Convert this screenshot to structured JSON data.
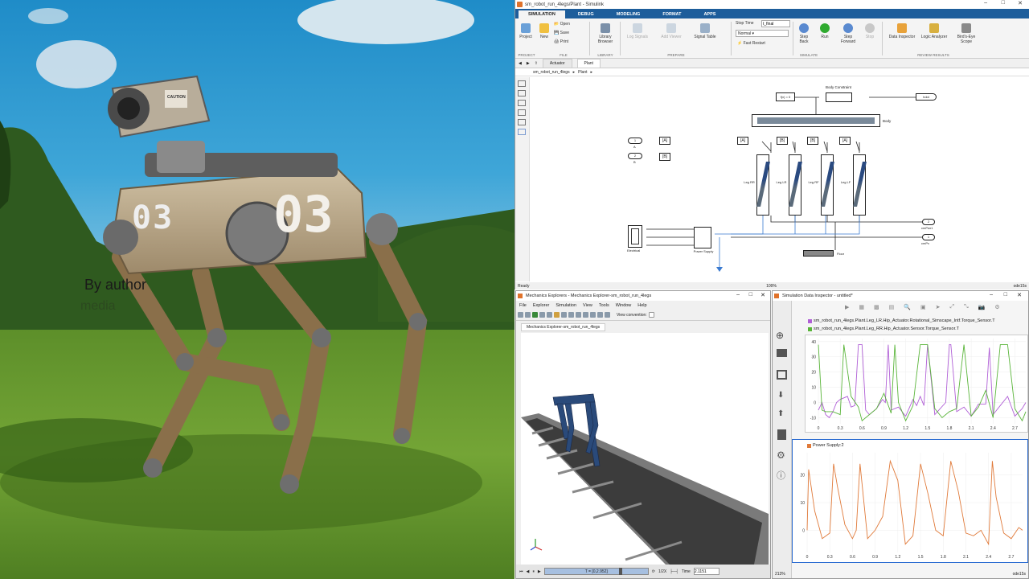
{
  "photo": {
    "watermark": "By author",
    "subwatermark": "media",
    "robot_number_left": "03",
    "robot_number_front": "03",
    "caution": "CAUTION"
  },
  "simulink": {
    "window_title": "sm_robot_run_4legs/Plant - Simulink",
    "tabs": [
      "SIMULATION",
      "DEBUG",
      "MODELING",
      "FORMAT",
      "APPS"
    ],
    "active_tab": "SIMULATION",
    "ribbon": {
      "project": "Project",
      "new": "New",
      "open": "Open",
      "save": "Save",
      "print": "Print",
      "library_browser": "Library Browser",
      "log_signals": "Log Signals",
      "add_viewer": "Add Viewer",
      "signal_table": "Signal Table",
      "stop_time_label": "Stop Time",
      "stop_time": "t_final",
      "mode": "Normal",
      "fast_restart": "Fast Restart",
      "step_back": "Step Back",
      "run": "Run",
      "step_forward": "Step Forward",
      "stop": "Stop",
      "data_inspector": "Data Inspector",
      "logic_analyzer": "Logic Analyzer",
      "birds_eye": "Bird's-Eye Scope",
      "groups": [
        "PROJECT",
        "FILE",
        "LIBRARY",
        "PREPARE",
        "SIMULATE",
        "REVIEW RESULTS"
      ]
    },
    "doc_tabs": [
      "Actuator",
      "Plant"
    ],
    "breadcrumb": [
      "sm_robot_run_4legs",
      "Plant"
    ],
    "status_left": "Ready",
    "status_mid": "109%",
    "status_right": "ode15s",
    "diagram": {
      "fx": "f(x) = 0",
      "body_constraint": "Body Constraint",
      "hdot": "hdot",
      "body": "Body",
      "inA": "1",
      "inB": "2",
      "portA": "A",
      "portB": "B",
      "gotoA": "[A]",
      "gotoB": "[B]",
      "legs": [
        {
          "tag": "[A]",
          "name": "Leg RR"
        },
        {
          "tag": "[B]",
          "name": "Leg LR"
        },
        {
          "tag": "[B]",
          "name": "Leg RF"
        },
        {
          "tag": "[A]",
          "name": "Leg LF"
        }
      ],
      "out2": "2",
      "out1": "1",
      "out2_name": "cmPwr1",
      "out1_name": "cmPx",
      "electrical": "Electrical",
      "power": "Power Supply",
      "floor": "Floor"
    }
  },
  "mechanics": {
    "title": "Mechanics Explorers - Mechanics Explorer-sm_robot_run_4legs",
    "menu": [
      "File",
      "Explorer",
      "Simulation",
      "View",
      "Tools",
      "Window",
      "Help"
    ],
    "view_convention": "View convention:",
    "tab": "Mechanics Explorer-sm_robot_run_4legs",
    "time_readout": "T = [0,2.952]",
    "speed": "1/2X",
    "time_label": "Time",
    "time_value": "2.1151"
  },
  "sdi": {
    "title": "Simulation Data Inspector - untitled*",
    "legend1": "sm_robot_run_4legs.Plant.Leg_LR.Hip_Actuator.Rotational_Simscape_Intf.Torque_Sensor.T",
    "legend2": "sm_robot_run_4legs.Plant.Leg_RR.Hip_Actuator.Sensor.Torque_Sensor.T",
    "legend3": "Power Supply:2",
    "status_left": "213%",
    "status_right": "ode15s",
    "colors": {
      "purple": "#b05fd6",
      "green": "#5ab53a",
      "orange": "#e07a3a"
    }
  },
  "chart_data": [
    {
      "type": "line",
      "title": "",
      "xlabel": "",
      "ylabel": "",
      "x_ticks": [
        "0",
        "0.3",
        "0.6",
        "0.9",
        "1.2",
        "1.5",
        "1.8",
        "2.1",
        "2.4",
        "2.7"
      ],
      "y_ticks": [
        "40",
        "30",
        "20",
        "10",
        "0",
        "-10"
      ],
      "ylim": [
        -14,
        42
      ],
      "xlim": [
        0,
        2.85
      ],
      "series": [
        {
          "name": "sm_robot_run_4legs.Plant.Leg_LR.Hip_Actuator.Rotational_Simscape_Intf.Torque_Sensor.T",
          "color": "#b05fd6",
          "x": [
            0,
            0.05,
            0.1,
            0.15,
            0.2,
            0.25,
            0.3,
            0.4,
            0.45,
            0.5,
            0.55,
            0.6,
            0.65,
            0.7,
            0.8,
            0.88,
            0.92,
            0.96,
            1.0,
            1.1,
            1.2,
            1.3,
            1.35,
            1.4,
            1.45,
            1.5,
            1.6,
            1.75,
            1.8,
            1.82,
            1.9,
            2.0,
            2.1,
            2.2,
            2.3,
            2.35,
            2.4,
            2.5,
            2.6,
            2.7,
            2.8,
            2.85
          ],
          "y": [
            -5,
            0,
            -8,
            -10,
            -6,
            0,
            2,
            4,
            -3,
            -2,
            38,
            38,
            -5,
            -8,
            -4,
            2,
            0,
            38,
            -5,
            -3,
            -9,
            2,
            -2,
            4,
            -2,
            38,
            -8,
            0,
            38,
            38,
            -6,
            -3,
            -9,
            -1,
            -1,
            36,
            -8,
            -2,
            4,
            -9,
            -4,
            0
          ]
        },
        {
          "name": "sm_robot_run_4legs.Plant.Leg_RR.Hip_Actuator.Sensor.Torque_Sensor.T",
          "color": "#5ab53a",
          "x": [
            0,
            0.05,
            0.1,
            0.2,
            0.3,
            0.35,
            0.45,
            0.55,
            0.6,
            0.7,
            0.8,
            0.9,
            1.0,
            1.05,
            1.1,
            1.2,
            1.3,
            1.4,
            1.5,
            1.6,
            1.7,
            1.8,
            1.9,
            2.0,
            2.1,
            2.2,
            2.3,
            2.4,
            2.5,
            2.6,
            2.7,
            2.8,
            2.85
          ],
          "y": [
            38,
            -5,
            -6,
            -6,
            -8,
            38,
            4,
            -3,
            -12,
            -8,
            -4,
            6,
            -7,
            38,
            0,
            -12,
            -2,
            38,
            38,
            -4,
            -10,
            -6,
            -4,
            38,
            -9,
            -3,
            8,
            -10,
            38,
            38,
            -4,
            -12,
            -6
          ]
        }
      ]
    },
    {
      "type": "line",
      "title": "",
      "xlabel": "",
      "ylabel": "",
      "x_ticks": [
        "0",
        "0.3",
        "0.6",
        "0.9",
        "1.2",
        "1.5",
        "1.8",
        "2.1",
        "2.4",
        "2.7"
      ],
      "y_ticks": [
        "20",
        "10",
        "0"
      ],
      "ylim": [
        -8,
        28
      ],
      "xlim": [
        0,
        2.85
      ],
      "series": [
        {
          "name": "Power Supply:2",
          "color": "#e07a3a",
          "x": [
            0,
            0.02,
            0.1,
            0.2,
            0.3,
            0.35,
            0.4,
            0.5,
            0.6,
            0.65,
            0.7,
            0.8,
            0.9,
            1.0,
            1.1,
            1.2,
            1.3,
            1.4,
            1.5,
            1.6,
            1.7,
            1.8,
            1.9,
            2.0,
            2.1,
            2.2,
            2.3,
            2.4,
            2.45,
            2.5,
            2.6,
            2.7,
            2.8,
            2.85
          ],
          "y": [
            0,
            22,
            7,
            -3,
            -1,
            24,
            16,
            2,
            -3,
            0,
            24,
            -3,
            0,
            5,
            25,
            18,
            -5,
            -2,
            24,
            13,
            0,
            -2,
            25,
            14,
            -1,
            -2,
            0,
            -5,
            25,
            12,
            -1,
            -3,
            1,
            0
          ]
        }
      ]
    }
  ]
}
